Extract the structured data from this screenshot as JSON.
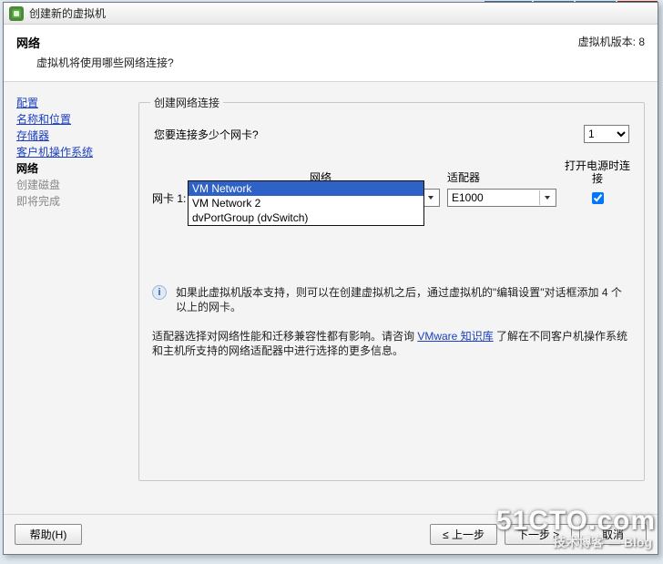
{
  "window": {
    "title": "创建新的虚拟机"
  },
  "header": {
    "title": "网络",
    "subtitle": "虚拟机将使用哪些网络连接?",
    "version_label": "虚拟机版本: 8"
  },
  "sidebar": {
    "items": [
      {
        "label": "配置",
        "state": "done"
      },
      {
        "label": "名称和位置",
        "state": "done"
      },
      {
        "label": "存储器",
        "state": "done"
      },
      {
        "label": "客户机操作系统",
        "state": "done"
      },
      {
        "label": "网络",
        "state": "current"
      },
      {
        "label": "创建磁盘",
        "state": "todo"
      },
      {
        "label": "即将完成",
        "state": "todo"
      }
    ]
  },
  "group": {
    "legend": "创建网络连接",
    "question": "您要连接多少个网卡?",
    "nic_count_options": [
      "1"
    ],
    "nic_count_value": "1",
    "columns": {
      "network": "网络",
      "adapter": "适配器",
      "connect": "打开电源时连接"
    },
    "nic_row": {
      "label": "网卡 1:",
      "network_value": "VM Network",
      "network_options": [
        "VM Network",
        "VM Network 2",
        "dvPortGroup (dvSwitch)"
      ],
      "adapter_value": "E1000",
      "connect_checked": true
    },
    "info": "如果此虚拟机版本支持，则可以在创建虚拟机之后，通过虚拟机的\"编辑设置\"对话框添加 4 个以上的网卡。",
    "adapter_note_pre": "适配器选择对网络性能和迁移兼容性都有影响。请咨询 ",
    "adapter_note_link": "VMware 知识库",
    "adapter_note_post": " 了解在不同客户机操作系统和主机所支持的网络适配器中进行选择的更多信息。"
  },
  "footer": {
    "help": "帮助(H)",
    "back": "≤ 上一步",
    "next": "下一步 ≥",
    "cancel": "取消"
  },
  "watermark": {
    "line1": "51CTO.com",
    "line2": "技术博客 — Blog"
  },
  "bg_winctrls": {
    "restore": "⧉",
    "min": "—",
    "max": "☐",
    "close": "✕"
  }
}
